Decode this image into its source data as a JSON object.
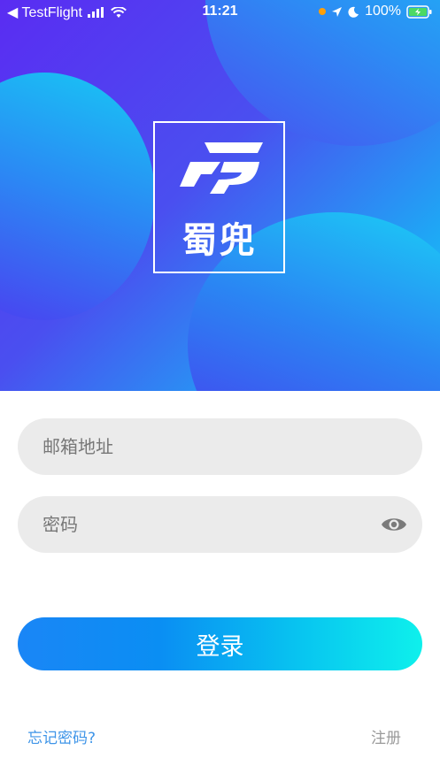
{
  "status_bar": {
    "back_app": "◀ TestFlight",
    "time": "11:21",
    "battery": "100%"
  },
  "brand": {
    "name": "蜀兜"
  },
  "email": {
    "placeholder": "邮箱地址",
    "value": ""
  },
  "password": {
    "placeholder": "密码",
    "value": ""
  },
  "login": {
    "label": "登录"
  },
  "links": {
    "forgot": "忘记密码?",
    "register": "注册"
  },
  "colors": {
    "accent": "#0a8ef3",
    "link": "#3f95e8",
    "field_bg": "#ebebeb"
  },
  "icons": [
    "cellular-signal-icon",
    "wifi-icon",
    "location-arrow-icon",
    "moon-icon",
    "battery-icon",
    "eye-icon"
  ]
}
